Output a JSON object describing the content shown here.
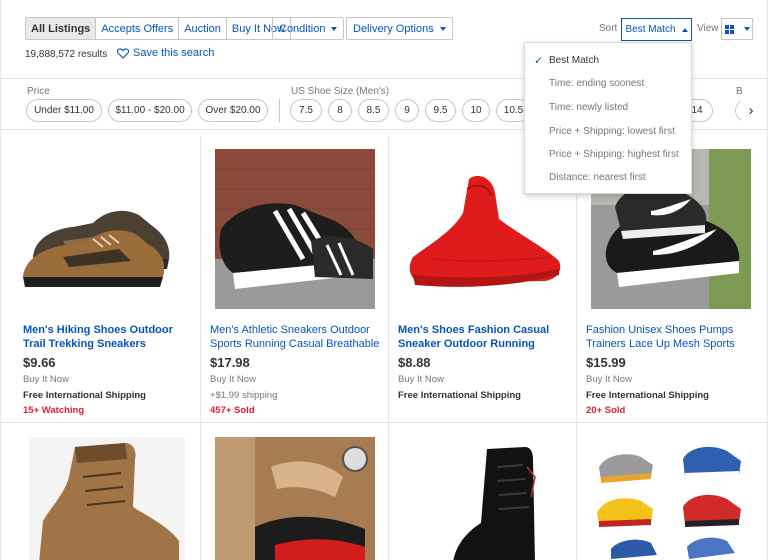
{
  "toolbar": {
    "tabs": [
      "All Listings",
      "Accepts Offers",
      "Auction",
      "Buy It Now"
    ],
    "condition": "Condition",
    "delivery": "Delivery Options"
  },
  "results_count": "19,888,572 results",
  "save_search": "Save this search",
  "sort": {
    "label": "Sort",
    "selected": "Best Match",
    "options": [
      "Best Match",
      "Time: ending soonest",
      "Time: newly listed",
      "Price + Shipping: lowest first",
      "Price + Shipping: highest first",
      "Distance: nearest first"
    ]
  },
  "view_label": "View",
  "filters": {
    "price_label": "Price",
    "price_options": [
      "Under $11.00",
      "$11.00 - $20.00",
      "Over $20.00"
    ],
    "size_label": "US Shoe Size (Men's)",
    "size_options": [
      "7.5",
      "8",
      "8.5",
      "9",
      "9.5",
      "10",
      "10.5",
      "14"
    ],
    "partial_label": "B"
  },
  "colors": {
    "link": "#0654ba",
    "alert": "#dd1e31"
  },
  "products": [
    {
      "title": "Men's Hiking Shoes Outdoor Trail Trekking Sneakers Breathable",
      "price": "$9.66",
      "format": "Buy It Now",
      "shipping": "Free International Shipping",
      "badge": "15+ Watching"
    },
    {
      "title": "Men's Athletic Sneakers Outdoor Sports Running Casual Breathable",
      "price": "$17.98",
      "format": "Buy It Now",
      "shipping": "+$1.99 shipping",
      "badge": "457+ Sold"
    },
    {
      "title": "Men's Shoes Fashion Casual Sneaker Outdoor Running",
      "price": "$8.88",
      "format": "Buy It Now",
      "shipping": "Free International Shipping",
      "badge": ""
    },
    {
      "title": "Fashion Unisex Shoes Pumps Trainers Lace Up Mesh Sports",
      "price": "$15.99",
      "format": "Buy It Now",
      "shipping": "Free International Shipping",
      "badge": "20+ Sold"
    }
  ]
}
